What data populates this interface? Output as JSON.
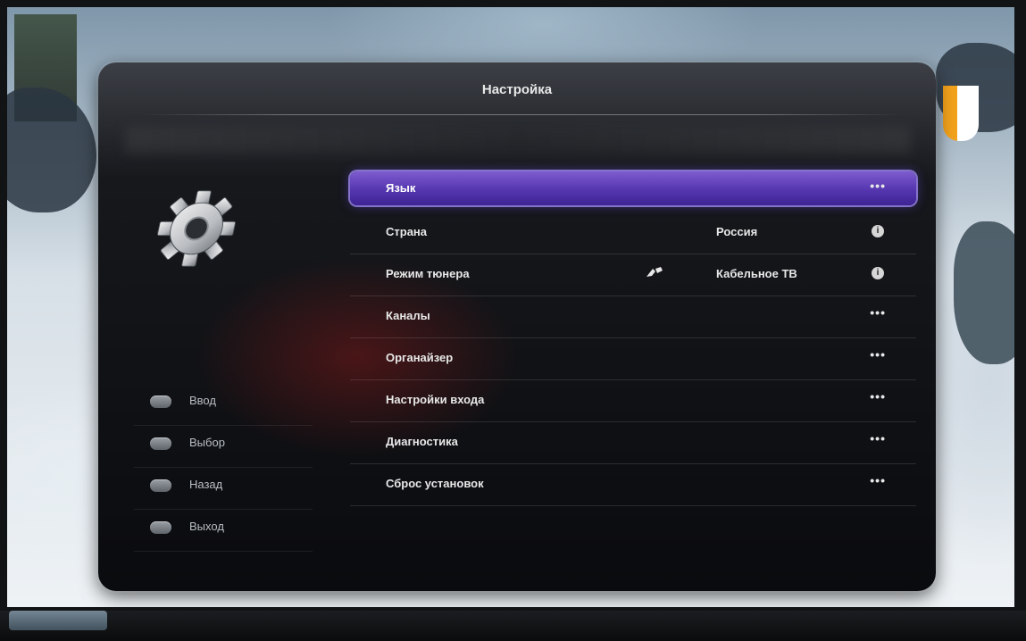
{
  "menu": {
    "title": "Настройка"
  },
  "settings": [
    {
      "label": "Язык",
      "value": "",
      "action": "•••",
      "selected": true
    },
    {
      "label": "Страна",
      "value": "Россия",
      "action": "i",
      "selected": false
    },
    {
      "label": "Режим тюнера",
      "value": "Кабельное ТВ",
      "action": "i",
      "selected": false,
      "value_icon": "cable-icon"
    },
    {
      "label": "Каналы",
      "value": "",
      "action": "•••",
      "selected": false
    },
    {
      "label": "Органайзер",
      "value": "",
      "action": "•••",
      "selected": false
    },
    {
      "label": "Настройки входа",
      "value": "",
      "action": "•••",
      "selected": false
    },
    {
      "label": "Диагностика",
      "value": "",
      "action": "•••",
      "selected": false
    },
    {
      "label": "Сброс установок",
      "value": "",
      "action": "•••",
      "selected": false
    }
  ],
  "hints": [
    {
      "label": "Ввод"
    },
    {
      "label": "Выбор"
    },
    {
      "label": "Назад"
    },
    {
      "label": "Выход"
    }
  ],
  "colors": {
    "selection_accent": "#5a3bb8",
    "logo_accent": "#f3a21c"
  }
}
